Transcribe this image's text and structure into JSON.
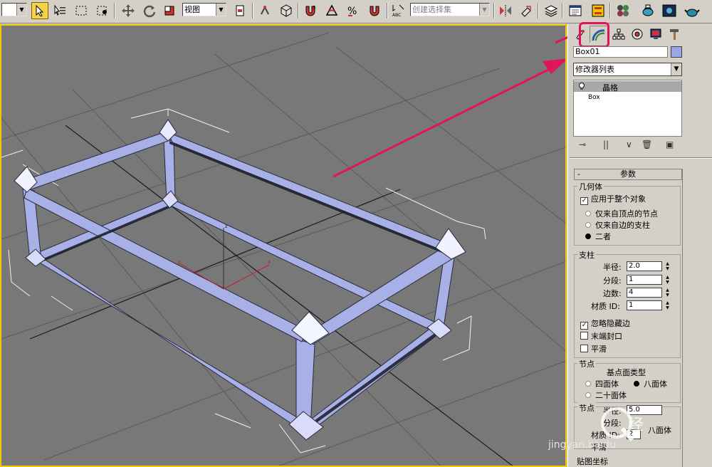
{
  "toolbar": {
    "view_combo": "视图",
    "selection_set_placeholder": "创建选择集"
  },
  "command_panel": {
    "object_name": "Box01",
    "modifier_list": "修改器列表",
    "stack": {
      "modifier": "晶格",
      "base_object": "Box"
    },
    "rollout_title": "参数",
    "geometry": {
      "label": "几何体",
      "apply_whole": "应用于整个对象",
      "apply_whole_checked": true,
      "options": [
        "仅来自顶点的节点",
        "仅来自边的支柱",
        "二者"
      ],
      "selected_index": 2
    },
    "struts": {
      "label": "支柱",
      "radius_label": "半径:",
      "radius_value": "2.0",
      "segments_label": "分段:",
      "segments_value": "1",
      "sides_label": "边数:",
      "sides_value": "4",
      "matid_label": "材质 ID:",
      "matid_value": "1",
      "ignore_hidden": "忽略隐藏边",
      "ignore_hidden_checked": true,
      "end_caps": "末端封口",
      "end_caps_checked": false,
      "smooth": "平滑",
      "smooth_checked": false
    },
    "joints": {
      "label": "节点",
      "base_type_label": "基点面类型",
      "tetra": "四面体",
      "octa": "八面体",
      "icosa": "二十面体",
      "selected": "八面体",
      "radius_label": "半径:",
      "radius_value": "5.0",
      "segments_label": "分段:",
      "matid_label": "材质 ID:",
      "matid_value": "2",
      "smooth": "平滑",
      "partial_label": "节点",
      "octa_partial": "八面体"
    },
    "mapping_label": "贴图坐标"
  },
  "viewport": {
    "axis_x": "x",
    "axis_y": "y",
    "axis_z": "z"
  },
  "watermark": {
    "text": "jingyan.baidu"
  },
  "colors": {
    "accent_highlight": "#e0145a",
    "viewport_bg": "#787878",
    "lattice": "#a8b0e8",
    "active_border": "#f0c800"
  }
}
